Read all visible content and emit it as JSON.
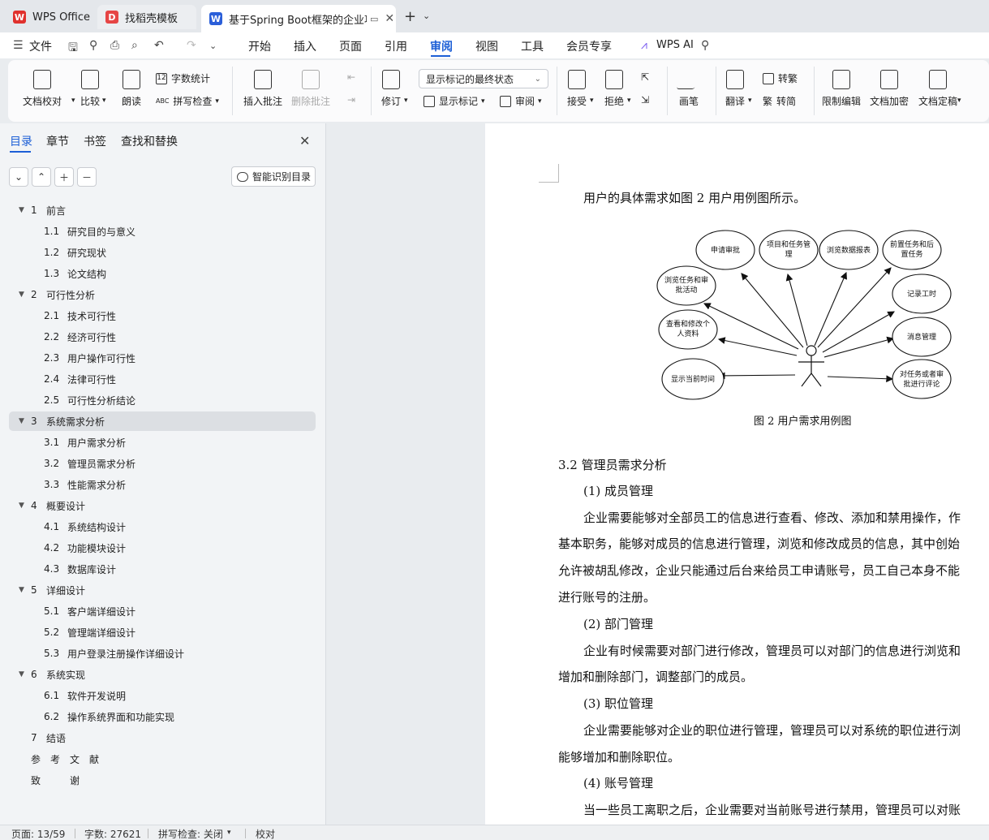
{
  "tabs": [
    {
      "label": "WPS Office",
      "icon": "wps-logo-icon",
      "color": "#e0312d"
    },
    {
      "label": "找稻壳模板",
      "icon": "docer-logo-icon",
      "color": "#e64545"
    },
    {
      "label": "基于Spring Boot框架的企业项",
      "icon": "word-doc-icon",
      "color": "#2b5fd9",
      "active": true
    }
  ],
  "menubar": {
    "file": "文件",
    "items": [
      "开始",
      "插入",
      "页面",
      "引用",
      "审阅",
      "视图",
      "工具",
      "会员专享"
    ],
    "active": "审阅",
    "ai": "WPS AI"
  },
  "ribbon": {
    "doc_check": "文档校对",
    "compare": "比较",
    "read_aloud": "朗读",
    "word_count": "字数统计",
    "spell_check": "拼写检查",
    "insert_comment": "插入批注",
    "delete_comment": "删除批注",
    "revise": "修订",
    "markup_dropdown": "显示标记的最终状态",
    "show_markup": "显示标记",
    "review": "审阅",
    "accept": "接受",
    "reject": "拒绝",
    "pen": "画笔",
    "translate": "翻译",
    "to_traditional": "转繁",
    "to_simplified": "转简",
    "restrict_edit": "限制编辑",
    "encrypt": "文档加密",
    "finalize": "文档定稿",
    "abc": "ABC",
    "wc_num": "12",
    "trad_char": "繁"
  },
  "nav": {
    "tabs": [
      "目录",
      "章节",
      "书签",
      "查找和替换"
    ],
    "active_tab": "目录",
    "smart_toc": "智能识别目录",
    "toc": [
      {
        "num": "1",
        "title": "前言",
        "level": 1,
        "expanded": true
      },
      {
        "num": "1.1",
        "title": "研究目的与意义",
        "level": 2
      },
      {
        "num": "1.2",
        "title": "研究现状",
        "level": 2
      },
      {
        "num": "1.3",
        "title": "论文结构",
        "level": 2
      },
      {
        "num": "2",
        "title": "可行性分析",
        "level": 1,
        "expanded": true
      },
      {
        "num": "2.1",
        "title": "技术可行性",
        "level": 2
      },
      {
        "num": "2.2",
        "title": "经济可行性",
        "level": 2
      },
      {
        "num": "2.3",
        "title": "用户操作可行性",
        "level": 2
      },
      {
        "num": "2.4",
        "title": "法律可行性",
        "level": 2
      },
      {
        "num": "2.5",
        "title": "可行性分析结论",
        "level": 2
      },
      {
        "num": "3",
        "title": "系统需求分析",
        "level": 1,
        "expanded": true,
        "selected": true
      },
      {
        "num": "3.1",
        "title": "用户需求分析",
        "level": 2
      },
      {
        "num": "3.2",
        "title": "管理员需求分析",
        "level": 2
      },
      {
        "num": "3.3",
        "title": "性能需求分析",
        "level": 2
      },
      {
        "num": "4",
        "title": "概要设计",
        "level": 1,
        "expanded": true
      },
      {
        "num": "4.1",
        "title": "系统结构设计",
        "level": 2
      },
      {
        "num": "4.2",
        "title": "功能模块设计",
        "level": 2
      },
      {
        "num": "4.3",
        "title": "数据库设计",
        "level": 2
      },
      {
        "num": "5",
        "title": "详细设计",
        "level": 1,
        "expanded": true
      },
      {
        "num": "5.1",
        "title": "客户端详细设计",
        "level": 2
      },
      {
        "num": "5.2",
        "title": "管理端详细设计",
        "level": 2
      },
      {
        "num": "5.3",
        "title": "用户登录注册操作详细设计",
        "level": 2
      },
      {
        "num": "6",
        "title": "系统实现",
        "level": 1,
        "expanded": true
      },
      {
        "num": "6.1",
        "title": "软件开发说明",
        "level": 2
      },
      {
        "num": "6.2",
        "title": "操作系统界面和功能实现",
        "level": 2
      },
      {
        "num": "7",
        "title": "结语",
        "level": 1
      },
      {
        "num": "",
        "title": "参　考　文　献",
        "level": 1
      },
      {
        "num": "",
        "title": "致　　　谢",
        "level": 1
      }
    ]
  },
  "document": {
    "intro": "用户的具体需求如图 2 用户用例图所示。",
    "diagram_labels": {
      "u1": "申请审批",
      "u2": "项目和任务管理",
      "u3": "浏览数据报表",
      "u4": "前置任务和后置任务",
      "u5": "浏览任务和审批活动",
      "u6": "记录工时",
      "u7": "查看和修改个人资料",
      "u8": "消息管理",
      "u9": "显示当前时间",
      "u10": "对任务或者审批进行评论"
    },
    "caption": "图 2  用户需求用例图",
    "heading": "3.2    管理员需求分析",
    "lines": [
      "(1)  成员管理",
      "企业需要能够对全部员工的信息进行查看、修改、添加和禁用操作，作",
      "基本职务，能够对成员的信息进行管理，浏览和修改成员的信息，其中创始",
      "允许被胡乱修改，企业只能通过后台来给员工申请账号，员工自己本身不能",
      "进行账号的注册。",
      "(2)  部门管理",
      "企业有时候需要对部门进行修改，管理员可以对部门的信息进行浏览和",
      "增加和删除部门，调整部门的成员。",
      "(3)  职位管理",
      "企业需要能够对企业的职位进行管理，管理员可以对系统的职位进行浏",
      "能够增加和删除职位。",
      "(4)  账号管理",
      "当一些员工离职之后，企业需要对当前账号进行禁用，管理员可以对账"
    ]
  },
  "status": {
    "page": "页面: 13/59",
    "words": "字数: 27621",
    "spell": "拼写检查: 关闭",
    "proof": "校对"
  }
}
